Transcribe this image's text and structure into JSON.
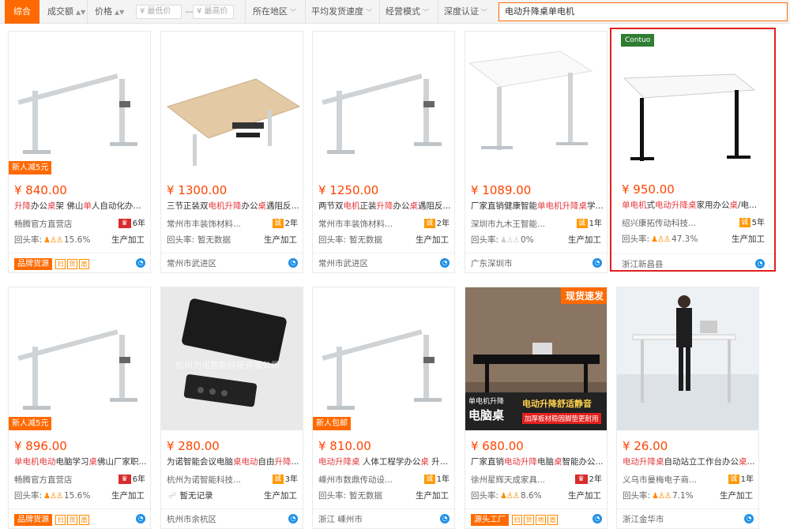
{
  "filterbar": {
    "tabs": [
      {
        "label": "综合",
        "active": true
      },
      {
        "label": "成交额",
        "sortable": true
      },
      {
        "label": "价格",
        "sortable": true
      }
    ],
    "price_min_placeholder": "¥ 最低价",
    "price_max_placeholder": "¥ 最高价",
    "price_dash": "—",
    "dropdowns": [
      "所在地区",
      "平均发货速度",
      "经营模式",
      "深度认证"
    ],
    "search_value": "电动升降桌单电机"
  },
  "products": [
    {
      "price": "¥ 840.00",
      "title_parts": [
        [
          "升降",
          true
        ],
        [
          "办公",
          false
        ],
        [
          "桌",
          true
        ],
        [
          "架 佛山",
          false
        ],
        [
          "单",
          true
        ],
        [
          "人自动化办公...",
          false
        ]
      ],
      "shop": "畅腾官方直营店",
      "badge": "crown",
      "years": "6年",
      "repeat_label": "回头率:",
      "repeat_rate": "15.6%",
      "business": "生产加工",
      "location": "",
      "promo": "新人减5元",
      "tag": "品牌货源",
      "icons": [
        "扫",
        "货",
        "盾"
      ],
      "highlight": false
    },
    {
      "price": "¥ 1300.00",
      "title_parts": [
        [
          "三节正装双",
          false
        ],
        [
          "电机",
          true
        ],
        [
          "升降",
          true
        ],
        [
          "办公",
          false
        ],
        [
          "桌",
          true
        ],
        [
          "遇阻反...",
          false
        ]
      ],
      "shop": "常州市丰装饰材料...",
      "badge": "cheng",
      "years": "2年",
      "repeat_label": "回头率:",
      "repeat_rate": "暂无数据",
      "business": "生产加工",
      "location": "常州市武进区",
      "promo": "",
      "tag": "",
      "icons": [],
      "highlight": false
    },
    {
      "price": "¥ 1250.00",
      "title_parts": [
        [
          "两节双",
          false
        ],
        [
          "电机",
          true
        ],
        [
          "正装",
          false
        ],
        [
          "升降",
          true
        ],
        [
          "办公",
          false
        ],
        [
          "桌",
          true
        ],
        [
          "遇阻反...",
          false
        ]
      ],
      "shop": "常州市丰装饰材料...",
      "badge": "cheng",
      "years": "2年",
      "repeat_label": "回头率:",
      "repeat_rate": "暂无数据",
      "business": "生产加工",
      "location": "常州市武进区",
      "promo": "",
      "tag": "",
      "icons": [],
      "highlight": false
    },
    {
      "price": "¥ 1089.00",
      "title_parts": [
        [
          "厂家直销健康智能",
          false
        ],
        [
          "单电机升降桌",
          true
        ],
        [
          "学...",
          false
        ]
      ],
      "shop": "深圳市九木王智能...",
      "badge": "cheng",
      "years": "1年",
      "repeat_label": "回头率:",
      "repeat_rate": "0%",
      "business": "生产加工",
      "location": "广东深圳市",
      "promo": "",
      "tag": "",
      "icons": [],
      "highlight": false
    },
    {
      "price": "¥ 950.00",
      "title_parts": [
        [
          "单电机",
          true
        ],
        [
          "式",
          false
        ],
        [
          "电动升降桌",
          true
        ],
        [
          "家用办公",
          false
        ],
        [
          "桌",
          true
        ],
        [
          "/电...",
          false
        ]
      ],
      "shop": "绍兴康拓传动科技...",
      "badge": "cheng",
      "years": "5年",
      "repeat_label": "回头率:",
      "repeat_rate": "47.3%",
      "business": "生产加工",
      "location": "浙江新昌县",
      "promo": "",
      "tag": "",
      "icons": [],
      "highlight": true,
      "logo": "Contuo"
    },
    {
      "price": "¥ 896.00",
      "title_parts": [
        [
          "单电机电动",
          true
        ],
        [
          "电脑学习",
          false
        ],
        [
          "桌",
          true
        ],
        [
          "佛山厂家职...",
          false
        ]
      ],
      "shop": "畅腾官方直营店",
      "badge": "crown",
      "years": "6年",
      "repeat_label": "回头率:",
      "repeat_rate": "15.6%",
      "business": "生产加工",
      "location": "",
      "promo": "新人减5元",
      "tag": "品牌货源",
      "icons": [
        "扫",
        "货",
        "盾"
      ],
      "highlight": false
    },
    {
      "price": "¥ 280.00",
      "title_parts": [
        [
          "为诺智能会议电脑",
          false
        ],
        [
          "桌电动",
          true
        ],
        [
          "自由",
          false
        ],
        [
          "升降",
          true
        ],
        [
          "...",
          false
        ]
      ],
      "shop": "杭州为诺智能科技...",
      "badge": "cheng",
      "years": "3年",
      "repeat_label": "",
      "repeat_rate": "暂无记录",
      "business": "生产加工",
      "location": "杭州市余杭区",
      "promo": "",
      "tag": "",
      "icons": [],
      "highlight": false,
      "watermark": "杭州为诺智能科技有限公司"
    },
    {
      "price": "¥ 810.00",
      "title_parts": [
        [
          "电动升降桌",
          true
        ],
        [
          " 人体工程学办公",
          false
        ],
        [
          "桌",
          true
        ],
        [
          " 升降...",
          false
        ]
      ],
      "shop": "嵊州市数鼎传动设...",
      "badge": "cheng",
      "years": "1年",
      "repeat_label": "回头率:",
      "repeat_rate": "暂无数据",
      "business": "生产加工",
      "location": "浙江 嵊州市",
      "promo": "新人包邮",
      "tag": "",
      "icons": [],
      "highlight": false
    },
    {
      "price": "¥ 680.00",
      "title_parts": [
        [
          "厂家直销",
          false
        ],
        [
          "电动升降",
          true
        ],
        [
          "电脑",
          false
        ],
        [
          "桌",
          true
        ],
        [
          "智能办公...",
          false
        ]
      ],
      "shop": "徐州星辉天成家具...",
      "badge": "crown",
      "years": "2年",
      "repeat_label": "回头率:",
      "repeat_rate": "8.6%",
      "business": "生产加工",
      "location": "",
      "promo": "",
      "tag": "源头工厂",
      "icons": [
        "扫",
        "货",
        "地",
        "盾"
      ],
      "highlight": false,
      "overlay": {
        "top": "现货速发",
        "left": "单电机升降",
        "left_big": "电脑桌",
        "right": "电动升降舒适静音",
        "right_sub": "加厚板材稳固脚垫更耐用"
      }
    },
    {
      "price": "¥ 26.00",
      "title_parts": [
        [
          "电动升降桌",
          true
        ],
        [
          "自动站立工作台办公",
          false
        ],
        [
          "桌",
          true
        ],
        [
          "...",
          false
        ]
      ],
      "shop": "义乌市曼梅电子商...",
      "badge": "cheng",
      "years": "1年",
      "repeat_label": "回头率:",
      "repeat_rate": "7.1%",
      "business": "生产加工",
      "location": "浙江金华市",
      "promo": "",
      "tag": "",
      "icons": [],
      "highlight": false
    }
  ],
  "icon_names": {
    "wangwang": "wangwang-chat-icon",
    "cheng": "chengxintong-badge-icon",
    "crown": "crown-badge-icon"
  },
  "colors": {
    "accent": "#ff6a00",
    "price": "#ff4400",
    "keyword": "#e4393c",
    "highlight_border": "#e2201d"
  }
}
